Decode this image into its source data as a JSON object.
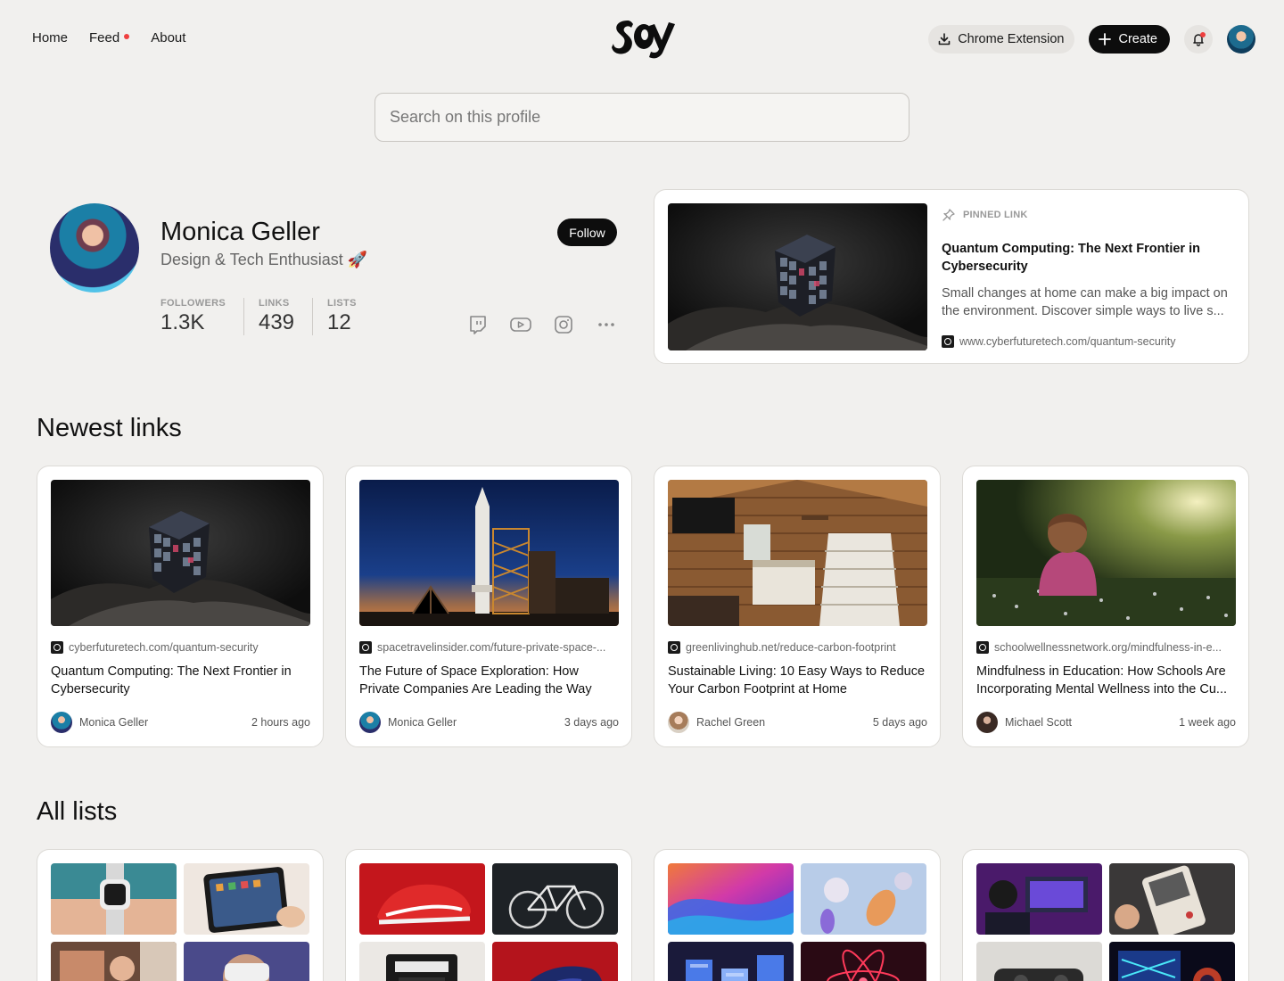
{
  "nav": {
    "home": "Home",
    "feed": "Feed",
    "about": "About",
    "logo_text": "soy",
    "chrome_extension": "Chrome Extension",
    "create": "Create"
  },
  "search": {
    "placeholder": "Search on this profile"
  },
  "profile": {
    "name": "Monica Geller",
    "bio": "Design & Tech Enthusiast 🚀",
    "follow_label": "Follow",
    "stats": [
      {
        "label": "FOLLOWERS",
        "value": "1.3K"
      },
      {
        "label": "LINKS",
        "value": "439"
      },
      {
        "label": "LISTS",
        "value": "12"
      }
    ],
    "socials": [
      "twitch-icon",
      "youtube-icon",
      "instagram-icon",
      "more-icon"
    ]
  },
  "pinned": {
    "tag": "PINNED LINK",
    "title": "Quantum Computing: The Next Frontier in Cybersecurity",
    "description": "Small changes at home can make a big impact on the environment. Discover simple ways to live s...",
    "url": "www.cyberfuturetech.com/quantum-security"
  },
  "sections": {
    "newest": "Newest links",
    "lists": "All lists"
  },
  "links": [
    {
      "url": "cyberfuturetech.com/quantum-security",
      "title": "Quantum Computing: The Next Frontier in Cybersecurity",
      "author": "Monica Geller",
      "time": "2 hours ago",
      "image": "cube"
    },
    {
      "url": "spacetravelinsider.com/future-private-space-...",
      "title": "The Future of Space Exploration: How Private Companies Are Leading the Way",
      "author": "Monica Geller",
      "time": "3 days ago",
      "image": "rocket"
    },
    {
      "url": "greenlivinghub.net/reduce-carbon-footprint",
      "title": "Sustainable Living: 10 Easy Ways to Reduce Your Carbon Footprint at Home",
      "author": "Rachel Green",
      "time": "5 days ago",
      "image": "cabin"
    },
    {
      "url": "schoolwellnessnetwork.org/mindfulness-in-e...",
      "title": "Mindfulness in Education: How Schools Are Incorporating Mental Wellness into the Cu...",
      "author": "Michael Scott",
      "time": "1 week ago",
      "image": "meadow"
    }
  ],
  "lists": [
    {
      "tiles": [
        "watch",
        "tablet",
        "workshop",
        "vr"
      ]
    },
    {
      "tiles": [
        "sneaker",
        "bicycle",
        "camera",
        "red-object"
      ]
    },
    {
      "tiles": [
        "gradient-waves",
        "spheres",
        "blue-city",
        "neon-atom"
      ]
    },
    {
      "tiles": [
        "purple-setup",
        "handheld-console",
        "console",
        "neon-screen"
      ]
    }
  ]
}
